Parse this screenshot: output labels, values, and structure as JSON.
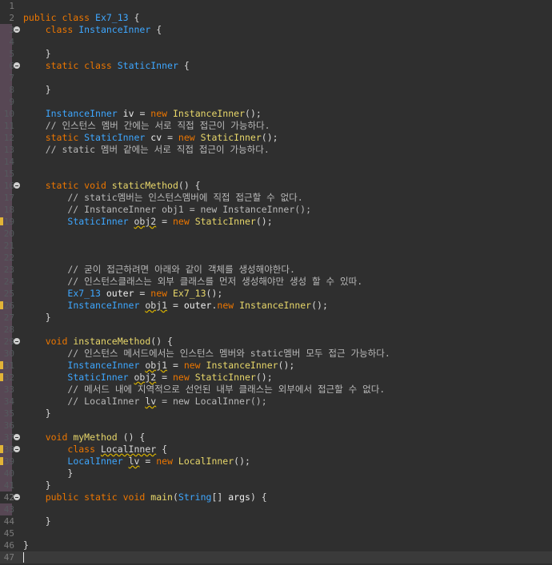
{
  "editor": {
    "colors": {
      "background": "#2f2f2f",
      "keyword": "#ec7600",
      "type": "#3ea7ff",
      "method": "#e8d76a",
      "field": "#eeeeee",
      "comment": "#b9b9b9",
      "line_number": "#7c7c7c",
      "warning": "#e2b437"
    },
    "lines": [
      {
        "n": "1",
        "t": []
      },
      {
        "n": "2",
        "t": [
          [
            "kw",
            "public class "
          ],
          [
            "ty",
            "Ex7_13"
          ],
          [
            "",
            " {"
          ]
        ]
      },
      {
        "n": "3",
        "fold": true,
        "bar": true,
        "t": [
          [
            "",
            "    "
          ],
          [
            "kw",
            "class "
          ],
          [
            "ty",
            "InstanceInner"
          ],
          [
            "",
            " {"
          ]
        ]
      },
      {
        "n": "4",
        "bar": true,
        "t": []
      },
      {
        "n": "5",
        "bar": true,
        "t": [
          [
            "",
            "    }"
          ]
        ]
      },
      {
        "n": "6",
        "fold": true,
        "bar": true,
        "t": [
          [
            "",
            "    "
          ],
          [
            "kw",
            "static class "
          ],
          [
            "ty",
            "StaticInner"
          ],
          [
            "",
            " {"
          ]
        ]
      },
      {
        "n": "7",
        "bar": true,
        "t": []
      },
      {
        "n": "8",
        "bar": true,
        "t": [
          [
            "",
            "    }"
          ]
        ]
      },
      {
        "n": "9",
        "bar": true,
        "t": []
      },
      {
        "n": "10",
        "bar": true,
        "t": [
          [
            "",
            "    "
          ],
          [
            "ty",
            "InstanceInner"
          ],
          [
            "",
            " "
          ],
          [
            "fd",
            "iv"
          ],
          [
            "",
            " = "
          ],
          [
            "kw",
            "new "
          ],
          [
            "fn",
            "InstanceInner"
          ],
          [
            "",
            "();"
          ]
        ]
      },
      {
        "n": "11",
        "bar": true,
        "t": [
          [
            "cm",
            "    // 인스턴스 멤버 간에는 서로 직접 접근이 가능하다."
          ]
        ]
      },
      {
        "n": "12",
        "bar": true,
        "t": [
          [
            "",
            "    "
          ],
          [
            "kw",
            "static "
          ],
          [
            "ty",
            "StaticInner"
          ],
          [
            "",
            " "
          ],
          [
            "fd",
            "cv"
          ],
          [
            "",
            " = "
          ],
          [
            "kw",
            "new "
          ],
          [
            "fn",
            "StaticInner"
          ],
          [
            "",
            "();"
          ]
        ]
      },
      {
        "n": "13",
        "bar": true,
        "t": [
          [
            "cm",
            "    // static 멤버 같에는 서로 직접 접근이 가능하다."
          ]
        ]
      },
      {
        "n": "14",
        "bar": true,
        "t": []
      },
      {
        "n": "15",
        "bar": true,
        "t": []
      },
      {
        "n": "16",
        "fold": true,
        "bar": true,
        "t": [
          [
            "",
            "    "
          ],
          [
            "kw",
            "static void "
          ],
          [
            "fn",
            "staticMethod"
          ],
          [
            "",
            "() {"
          ]
        ]
      },
      {
        "n": "17",
        "bar": true,
        "t": [
          [
            "cm",
            "        // static멤버는 인스턴스멤버에 직접 접근할 수 없다."
          ]
        ]
      },
      {
        "n": "18",
        "bar": true,
        "t": [
          [
            "cm",
            "        // InstanceInner obj1 = new InstanceInner();"
          ]
        ]
      },
      {
        "n": "19",
        "bar": true,
        "warn": true,
        "t": [
          [
            "",
            "        "
          ],
          [
            "ty",
            "StaticInner"
          ],
          [
            "",
            " "
          ],
          [
            "sq",
            "obj2"
          ],
          [
            "",
            " = "
          ],
          [
            "kw",
            "new "
          ],
          [
            "fn",
            "StaticInner"
          ],
          [
            "",
            "();"
          ]
        ]
      },
      {
        "n": "20",
        "bar": true,
        "t": []
      },
      {
        "n": "21",
        "bar": true,
        "t": []
      },
      {
        "n": "22",
        "bar": true,
        "t": []
      },
      {
        "n": "23",
        "bar": true,
        "t": [
          [
            "cm",
            "        // 굳이 접근하려면 아래와 같이 객체를 생성해야한다."
          ]
        ]
      },
      {
        "n": "24",
        "bar": true,
        "t": [
          [
            "cm",
            "        // 인스턴스클래스는 외부 클래스를 먼저 생성해야만 생성 할 수 있따."
          ]
        ]
      },
      {
        "n": "25",
        "bar": true,
        "t": [
          [
            "",
            "        "
          ],
          [
            "ty",
            "Ex7_13"
          ],
          [
            "",
            " "
          ],
          [
            "fd",
            "outer"
          ],
          [
            "",
            " = "
          ],
          [
            "kw",
            "new "
          ],
          [
            "fn",
            "Ex7_13"
          ],
          [
            "",
            "();"
          ]
        ]
      },
      {
        "n": "26",
        "bar": true,
        "warn": true,
        "t": [
          [
            "",
            "        "
          ],
          [
            "ty",
            "InstanceInner"
          ],
          [
            "",
            " "
          ],
          [
            "sq",
            "obj1"
          ],
          [
            "",
            " = "
          ],
          [
            "fd",
            "outer"
          ],
          [
            "",
            "."
          ],
          [
            "kw",
            "new "
          ],
          [
            "fn",
            "InstanceInner"
          ],
          [
            "",
            "();"
          ]
        ]
      },
      {
        "n": "27",
        "bar": true,
        "t": [
          [
            "",
            "    }"
          ]
        ]
      },
      {
        "n": "28",
        "bar": true,
        "t": []
      },
      {
        "n": "29",
        "fold": true,
        "bar": true,
        "t": [
          [
            "",
            "    "
          ],
          [
            "kw",
            "void "
          ],
          [
            "fn",
            "instanceMethod"
          ],
          [
            "",
            "() {"
          ]
        ]
      },
      {
        "n": "30",
        "bar": true,
        "t": [
          [
            "cm",
            "        // 인스턴스 메서드에서는 인스턴스 멤버와 static멤버 모두 접근 가능하다."
          ]
        ]
      },
      {
        "n": "31",
        "bar": true,
        "warn": true,
        "t": [
          [
            "",
            "        "
          ],
          [
            "ty",
            "InstanceInner"
          ],
          [
            "",
            " "
          ],
          [
            "sq",
            "obj1"
          ],
          [
            "",
            " = "
          ],
          [
            "kw",
            "new "
          ],
          [
            "fn",
            "InstanceInner"
          ],
          [
            "",
            "();"
          ]
        ]
      },
      {
        "n": "32",
        "bar": true,
        "warn": true,
        "t": [
          [
            "",
            "        "
          ],
          [
            "ty",
            "StaticInner"
          ],
          [
            "",
            " "
          ],
          [
            "sq",
            "obj2"
          ],
          [
            "",
            " = "
          ],
          [
            "kw",
            "new "
          ],
          [
            "fn",
            "StaticInner"
          ],
          [
            "",
            "();"
          ]
        ]
      },
      {
        "n": "33",
        "bar": true,
        "t": [
          [
            "cm",
            "        // 메서드 내에 지역적으로 선언된 내부 클래스는 외부에서 접근할 수 없다."
          ]
        ]
      },
      {
        "n": "34",
        "bar": true,
        "t": [
          [
            "cm",
            "        // LocalInner "
          ],
          [
            "sq",
            "lv"
          ],
          [
            "cm",
            " = new LocalInner();"
          ]
        ]
      },
      {
        "n": "35",
        "bar": true,
        "t": [
          [
            "",
            "    }"
          ]
        ]
      },
      {
        "n": "36",
        "bar": true,
        "t": []
      },
      {
        "n": "37",
        "fold": true,
        "bar": true,
        "t": [
          [
            "",
            "    "
          ],
          [
            "kw",
            "void "
          ],
          [
            "fn",
            "myMethod"
          ],
          [
            "",
            " () {"
          ]
        ]
      },
      {
        "n": "38",
        "fold": true,
        "bar": true,
        "warn": true,
        "t": [
          [
            "",
            "        "
          ],
          [
            "kw",
            "class "
          ],
          [
            "sq",
            "LocalInner"
          ],
          [
            "",
            " {"
          ]
        ]
      },
      {
        "n": "39",
        "bar": true,
        "warn": true,
        "t": [
          [
            "",
            "        "
          ],
          [
            "ty",
            "LocalInner"
          ],
          [
            "",
            " "
          ],
          [
            "sq",
            "lv"
          ],
          [
            "",
            " = "
          ],
          [
            "kw",
            "new "
          ],
          [
            "fn",
            "LocalInner"
          ],
          [
            "",
            "();"
          ]
        ]
      },
      {
        "n": "40",
        "bar": true,
        "t": [
          [
            "",
            "        }"
          ]
        ]
      },
      {
        "n": "41",
        "bar": true,
        "t": [
          [
            "",
            "    }"
          ]
        ]
      },
      {
        "n": "42",
        "fold": true,
        "t": [
          [
            "",
            "    "
          ],
          [
            "kw",
            "public static void "
          ],
          [
            "fn",
            "main"
          ],
          [
            "",
            "("
          ],
          [
            "ty",
            "String"
          ],
          [
            "",
            "[] "
          ],
          [
            "fd",
            "args"
          ],
          [
            "",
            ") {"
          ]
        ]
      },
      {
        "n": "43",
        "bar": true,
        "t": []
      },
      {
        "n": "44",
        "t": [
          [
            "",
            "    }"
          ]
        ]
      },
      {
        "n": "45",
        "t": []
      },
      {
        "n": "46",
        "t": [
          [
            "",
            "}"
          ]
        ]
      },
      {
        "n": "47",
        "current": true,
        "t": []
      }
    ]
  }
}
